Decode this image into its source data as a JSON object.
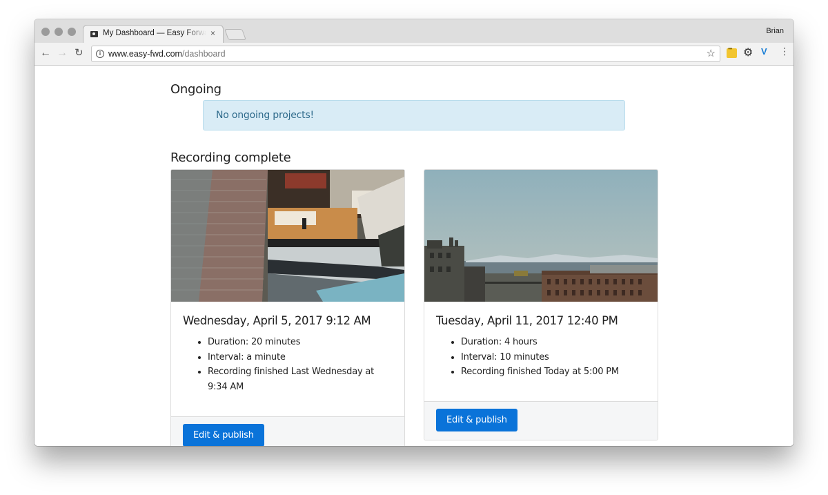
{
  "browser": {
    "tab_title": "My Dashboard — Easy Forward",
    "tab_close": "×",
    "profile_name": "Brian",
    "url_host": "www.easy-fwd.com",
    "url_path": "/dashboard",
    "icons": {
      "back": "back-arrow-icon",
      "forward": "forward-arrow-icon",
      "reload": "reload-icon",
      "info": "info-icon",
      "bookmark": "star-icon",
      "menu": "kebab-menu-icon"
    }
  },
  "page": {
    "ongoing_heading": "Ongoing",
    "ongoing_empty": "No ongoing projects!",
    "complete_heading": "Recording complete",
    "cards": [
      {
        "title": "Wednesday, April 5, 2017 9:12 AM",
        "duration": "Duration: 20 minutes",
        "interval": "Interval: a minute",
        "finished": "Recording finished Last Wednesday at 9:34 AM",
        "button": "Edit & publish"
      },
      {
        "title": "Tuesday, April 11, 2017 12:40 PM",
        "duration": "Duration: 4 hours",
        "interval": "Interval: 10 minutes",
        "finished": "Recording finished Today at 5:00 PM",
        "button": "Edit & publish"
      }
    ]
  },
  "colors": {
    "primary_button": "#0a73d9",
    "alert_bg": "#d9ecf6",
    "alert_text": "#2f6b8c"
  }
}
